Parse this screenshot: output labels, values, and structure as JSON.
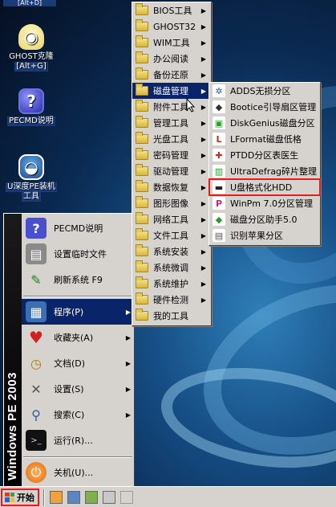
{
  "desktop": {
    "top_label": "[Alt+D]",
    "icons": [
      {
        "name": "GHOST克隆",
        "hotkey": "[Alt+G]"
      },
      {
        "name": "PECMD说明",
        "hotkey": ""
      },
      {
        "name": "U深度PE装机",
        "hotkey": "工具"
      }
    ]
  },
  "start_menu": {
    "banner": "Windows PE 2003",
    "top_items": [
      "PECMD说明",
      "设置临时文件",
      "刷新系统 F9"
    ],
    "items": [
      {
        "label": "程序(P)",
        "arrow": true,
        "highlighted": true
      },
      {
        "label": "收藏夹(A)",
        "arrow": true
      },
      {
        "label": "文档(D)",
        "arrow": true
      },
      {
        "label": "设置(S)",
        "arrow": true
      },
      {
        "label": "搜索(C)",
        "arrow": true
      },
      {
        "label": "运行(R)...",
        "arrow": false
      }
    ],
    "shutdown": "关机(U)..."
  },
  "programs_menu": [
    "BIOS工具",
    "GHOST32",
    "WIM工具",
    "办公阅读",
    "备份还原",
    "磁盘管理",
    "附件工具",
    "管理工具",
    "光盘工具",
    "密码管理",
    "驱动管理",
    "数据恢复",
    "图形图像",
    "网络工具",
    "文件工具",
    "系统安装",
    "系统微调",
    "系统维护",
    "硬件检测",
    "我的工具"
  ],
  "programs_highlighted": "磁盘管理",
  "disk_menu": [
    "ADDS无损分区",
    "Bootice引导扇区管理",
    "DiskGenius磁盘分区",
    "LFormat磁盘低格",
    "PTDD分区表医生",
    "UltraDefrag碎片整理",
    "U盘格式化HDD",
    "WinPm 7.0分区管理",
    "磁盘分区助手5.0",
    "识别苹果分区"
  ],
  "disk_boxed": "U盘格式化HDD",
  "taskbar": {
    "start_label": "开始"
  },
  "colors": {
    "highlight": "#0a246a",
    "menu_bg": "#d6d3ce",
    "annotation_box": "#e02020"
  }
}
